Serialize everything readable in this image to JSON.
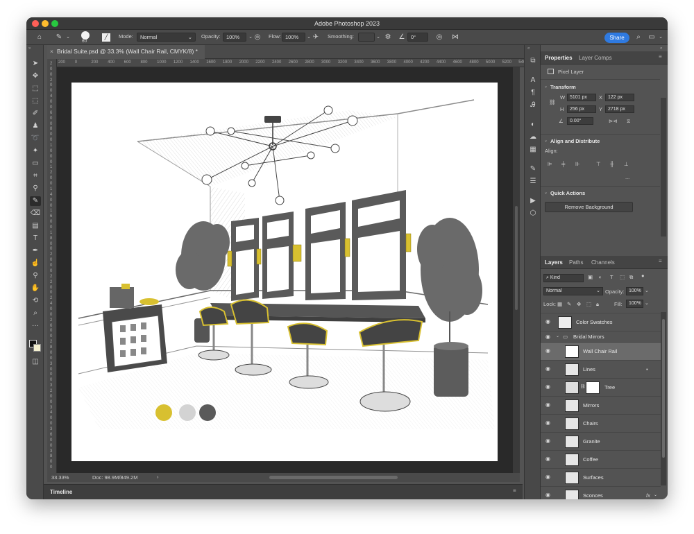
{
  "app": {
    "title": "Adobe Photoshop 2023"
  },
  "options": {
    "brush_size": "60",
    "mode_label": "Mode:",
    "mode_value": "Normal",
    "opacity_label": "Opacity:",
    "opacity_value": "100%",
    "flow_label": "Flow:",
    "flow_value": "100%",
    "smoothing_label": "Smoothing:",
    "angle_value": "0°",
    "share_label": "Share"
  },
  "document": {
    "tab_title": "Bridal Suite.psd @ 33.3% (Wall Chair Rail, CMYK/8) *",
    "ruler_top": [
      "200",
      "0",
      "200",
      "400",
      "600",
      "800",
      "1000",
      "1200",
      "1400",
      "1600",
      "1800",
      "2000",
      "2200",
      "2400",
      "2600",
      "2800",
      "3000",
      "3200",
      "3400",
      "3600",
      "3800",
      "4000",
      "4200",
      "4400",
      "4600",
      "4800",
      "5000",
      "5200",
      "5400"
    ],
    "ruler_left": [
      "2",
      "0",
      "0",
      "2",
      "0",
      "0",
      "4",
      "0",
      "0",
      "6",
      "0",
      "0",
      "8",
      "0",
      "0",
      "1",
      "0",
      "0",
      "0",
      "1",
      "2",
      "0",
      "0",
      "1",
      "4",
      "0",
      "0",
      "1",
      "6",
      "0",
      "0",
      "1",
      "8",
      "0",
      "0",
      "2",
      "0",
      "0",
      "0",
      "2",
      "2",
      "0",
      "0",
      "2",
      "4",
      "0",
      "0",
      "2",
      "6",
      "0",
      "0",
      "2",
      "8",
      "0",
      "0",
      "3",
      "0",
      "0",
      "0",
      "3",
      "2",
      "0",
      "0",
      "3",
      "4",
      "0",
      "0",
      "3",
      "6",
      "0",
      "0",
      "3",
      "8",
      "0",
      "0"
    ]
  },
  "status": {
    "zoom": "33.33%",
    "doc": "Doc: 98.9M/849.2M",
    "arrow": "›"
  },
  "timeline": {
    "label": "Timeline"
  },
  "properties": {
    "tabs": [
      "Properties",
      "Layer Comps"
    ],
    "kind": "Pixel Layer",
    "transform_title": "Transform",
    "w_label": "W",
    "w_value": "5101 px",
    "x_label": "X",
    "x_value": "122 px",
    "h_label": "H",
    "h_value": "256 px",
    "y_label": "Y",
    "y_value": "2718 px",
    "angle": "0.00°",
    "align_title": "Align and Distribute",
    "align_label": "Align:",
    "more": "...",
    "quick_title": "Quick Actions",
    "remove_bg": "Remove Background"
  },
  "layers": {
    "tabs": [
      "Layers",
      "Paths",
      "Channels"
    ],
    "kind_filter": "Kind",
    "blend_mode": "Normal",
    "opacity_label": "Opacity:",
    "opacity_value": "100%",
    "lock_label": "Lock:",
    "fill_label": "Fill:",
    "fill_value": "100%",
    "items": [
      {
        "name": "Color Swatches"
      },
      {
        "name": "Bridal Mirrors"
      },
      {
        "name": "Wall Chair Rail"
      },
      {
        "name": "Lines"
      },
      {
        "name": "Tree"
      },
      {
        "name": "Mirrors"
      },
      {
        "name": "Chairs"
      },
      {
        "name": "Granite"
      },
      {
        "name": "Coffee"
      },
      {
        "name": "Surfaces"
      },
      {
        "name": "Sconces"
      }
    ],
    "fx_label": "fx"
  },
  "colors": {
    "accent": "#d8c030",
    "share": "#2f7ae0",
    "swatch_yellow": "#d8c030",
    "swatch_light": "#d3d3d3",
    "swatch_dark": "#5a5a5a"
  }
}
